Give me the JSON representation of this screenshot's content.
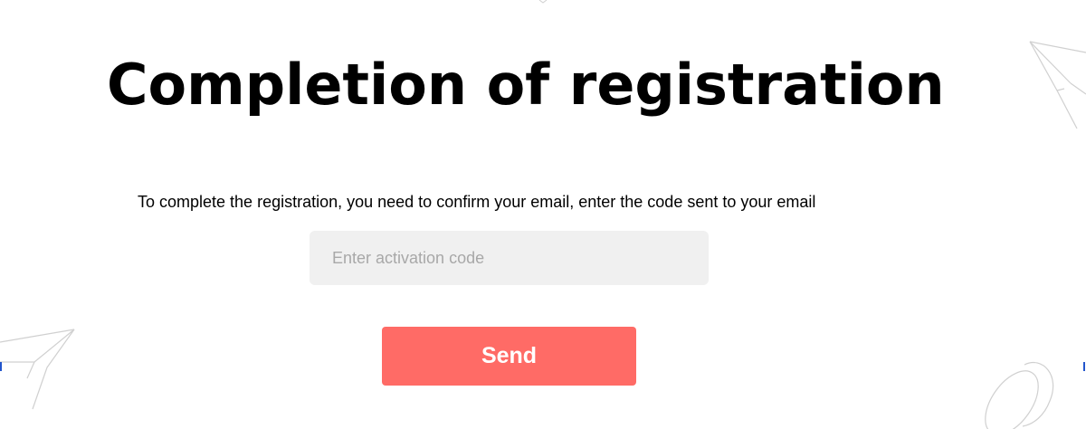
{
  "heading": "Completion of registration",
  "instructions": "To complete the registration, you need to confirm your email, enter the code sent to your email",
  "activation": {
    "value": "",
    "placeholder": "Enter activation code"
  },
  "send_label": "Send",
  "colors": {
    "button_background": "#ff6b66",
    "input_background": "#f0f0f0",
    "decoration_stroke": "#d0d0d0"
  },
  "icons": [
    "paper-plane-icon",
    "coin-icon"
  ]
}
